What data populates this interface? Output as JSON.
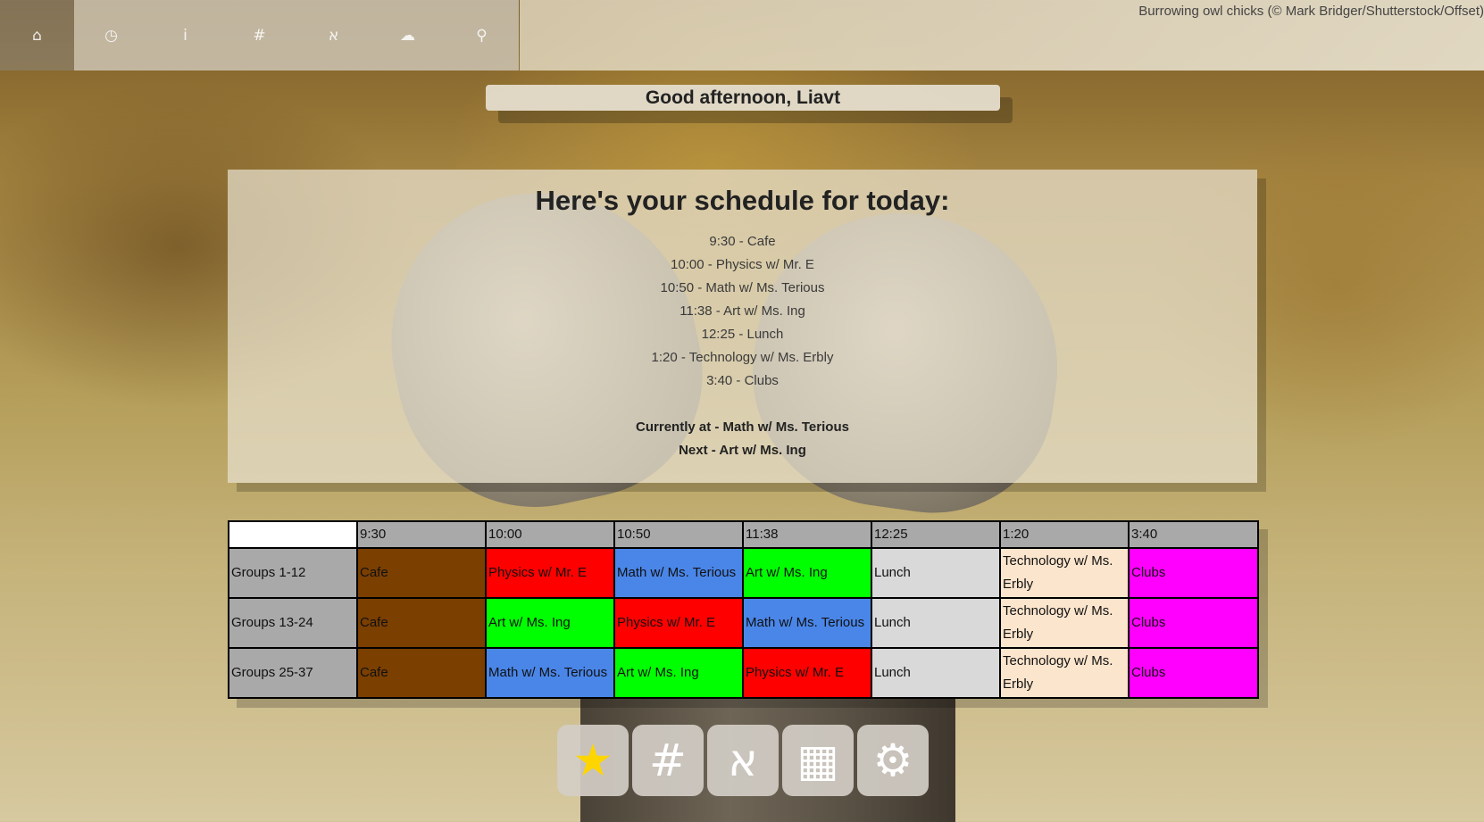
{
  "background": {
    "credit": "Burrowing owl chicks (© Mark Bridger/Shutterstock/Offset)"
  },
  "nav": {
    "items": [
      {
        "icon": "home-icon",
        "glyph": "⌂"
      },
      {
        "icon": "clock-icon",
        "glyph": "◷"
      },
      {
        "icon": "info-icon",
        "glyph": "ⅰ"
      },
      {
        "icon": "hash-icon",
        "glyph": "#"
      },
      {
        "icon": "aleph-icon",
        "glyph": "א"
      },
      {
        "icon": "palette-icon",
        "glyph": "☁"
      },
      {
        "icon": "wrench-icon",
        "glyph": "⚲"
      }
    ]
  },
  "greeting": "Good afternoon, Liavt",
  "schedule": {
    "title": "Here's your schedule for today:",
    "items": [
      "9:30 - Cafe",
      "10:00 - Physics w/ Mr. E",
      "10:50 - Math w/ Ms. Terious",
      "11:38 - Art w/ Ms. Ing",
      "12:25 - Lunch",
      "1:20 - Technology w/ Ms. Erbly",
      "3:40 - Clubs"
    ],
    "current": "Currently at - Math w/ Ms. Terious",
    "next": "Next - Art w/ Ms. Ing"
  },
  "grid": {
    "times": [
      "9:30",
      "10:00",
      "10:50",
      "11:38",
      "12:25",
      "1:20",
      "3:40"
    ],
    "rows": [
      {
        "group": "Groups 1-12",
        "cells": [
          {
            "text": "Cafe",
            "color": "#7b3f00"
          },
          {
            "text": "Physics w/ Mr. E",
            "color": "#ff0000"
          },
          {
            "text": "Math w/ Ms. Terious",
            "color": "#4a86e8"
          },
          {
            "text": "Art w/ Ms. Ing",
            "color": "#00ff00"
          },
          {
            "text": "Lunch",
            "color": "#d9d9d9"
          },
          {
            "text": "Technology w/ Ms. Erbly",
            "color": "#fce5cd"
          },
          {
            "text": "Clubs",
            "color": "#ff00ff"
          }
        ]
      },
      {
        "group": "Groups 13-24",
        "cells": [
          {
            "text": "Cafe",
            "color": "#7b3f00"
          },
          {
            "text": "Art w/ Ms. Ing",
            "color": "#00ff00"
          },
          {
            "text": "Physics w/ Mr. E",
            "color": "#ff0000"
          },
          {
            "text": "Math w/ Ms. Terious",
            "color": "#4a86e8"
          },
          {
            "text": "Lunch",
            "color": "#d9d9d9"
          },
          {
            "text": "Technology w/ Ms. Erbly",
            "color": "#fce5cd"
          },
          {
            "text": "Clubs",
            "color": "#ff00ff"
          }
        ]
      },
      {
        "group": "Groups 25-37",
        "cells": [
          {
            "text": "Cafe",
            "color": "#7b3f00"
          },
          {
            "text": "Math w/ Ms. Terious",
            "color": "#4a86e8"
          },
          {
            "text": "Art w/ Ms. Ing",
            "color": "#00ff00"
          },
          {
            "text": "Physics w/ Mr. E",
            "color": "#ff0000"
          },
          {
            "text": "Lunch",
            "color": "#d9d9d9"
          },
          {
            "text": "Technology w/ Ms. Erbly",
            "color": "#fce5cd"
          },
          {
            "text": "Clubs",
            "color": "#ff00ff"
          }
        ]
      }
    ]
  },
  "dock": [
    {
      "icon": "star-icon",
      "glyph": "★"
    },
    {
      "icon": "hash-icon",
      "glyph": "#"
    },
    {
      "icon": "aleph-icon",
      "glyph": "א"
    },
    {
      "icon": "grid-icon",
      "glyph": "▦"
    },
    {
      "icon": "gear-icon",
      "glyph": "⚙"
    }
  ]
}
